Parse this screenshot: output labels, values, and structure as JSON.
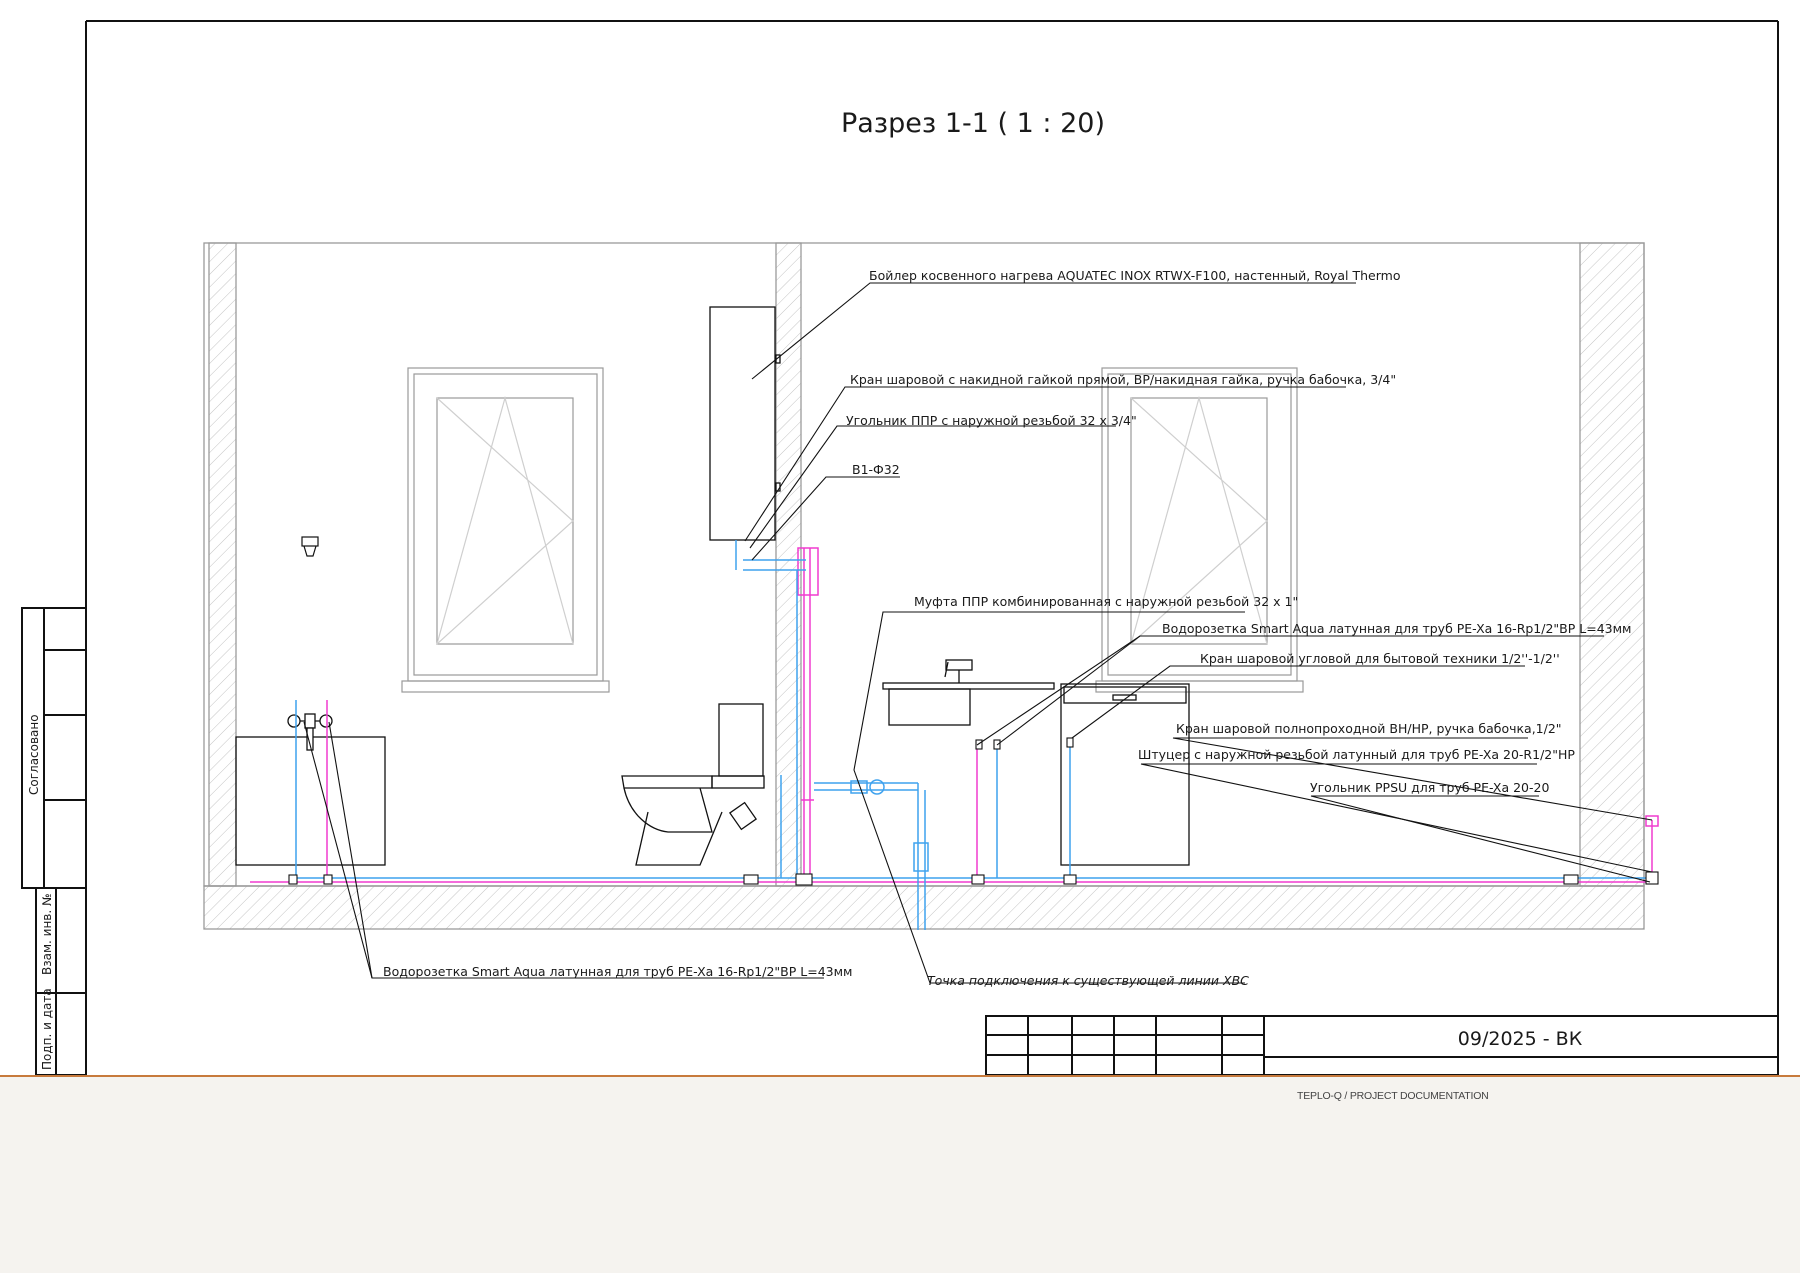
{
  "drawing": {
    "title": "Разрез 1-1 ( 1 : 20)",
    "sheet_code": "09/2025 - ВК",
    "stamp_labels": {
      "approved": "Согласовано",
      "inv_no": "Взам. инв. №",
      "sign_date": "Подп. и дата"
    },
    "colors": {
      "cold_water": "#3fa2ee",
      "hot_water": "#f03ccf",
      "line": "#111111",
      "wall_hatch": "#bdbdbd"
    }
  },
  "callouts": {
    "boiler": "Бойлер косвенного нагрева AQUATEC INOX RTWX-F100, настенный, Royal Thermo",
    "ball_valve_nut": "Кран шаровой с накидной гайкой прямой, ВР/накидная гайка, ручка бабочка, 3/4\"",
    "ppr_elbow": "Угольник ППР с наружной резьбой 32 х 3/4\"",
    "pipe_b1": "В1-Ф32",
    "ppr_coupling": "Муфта ППР комбинированная с наружной резьбой 32 х 1\"",
    "outlet_right": "Водорозетка Smart Aqua латунная для труб PE-Xa 16-Rp1/2\"ВР L=43мм",
    "angle_valve": "Кран шаровой угловой для бытовой техники 1/2''-1/2''",
    "full_bore_valve": "Кран шаровой полнопроходной  ВН/НР, ручка бабочка,1/2\"",
    "fitting": "Штуцер с наружной резьбой латунный для труб PE-Xa 20-R1/2\"НР",
    "ppsu_elbow": "Угольник PPSU для труб PE-Xa 20-20",
    "outlet_left": "Водорозетка Smart Aqua латунная для труб PE-Xa 16-Rp1/2\"ВР L=43мм",
    "connection_point": "Точка подключения к существующей линии ХВС"
  },
  "footer": {
    "label": "TEPLO-Q / PROJECT DOCUMENTATION"
  }
}
